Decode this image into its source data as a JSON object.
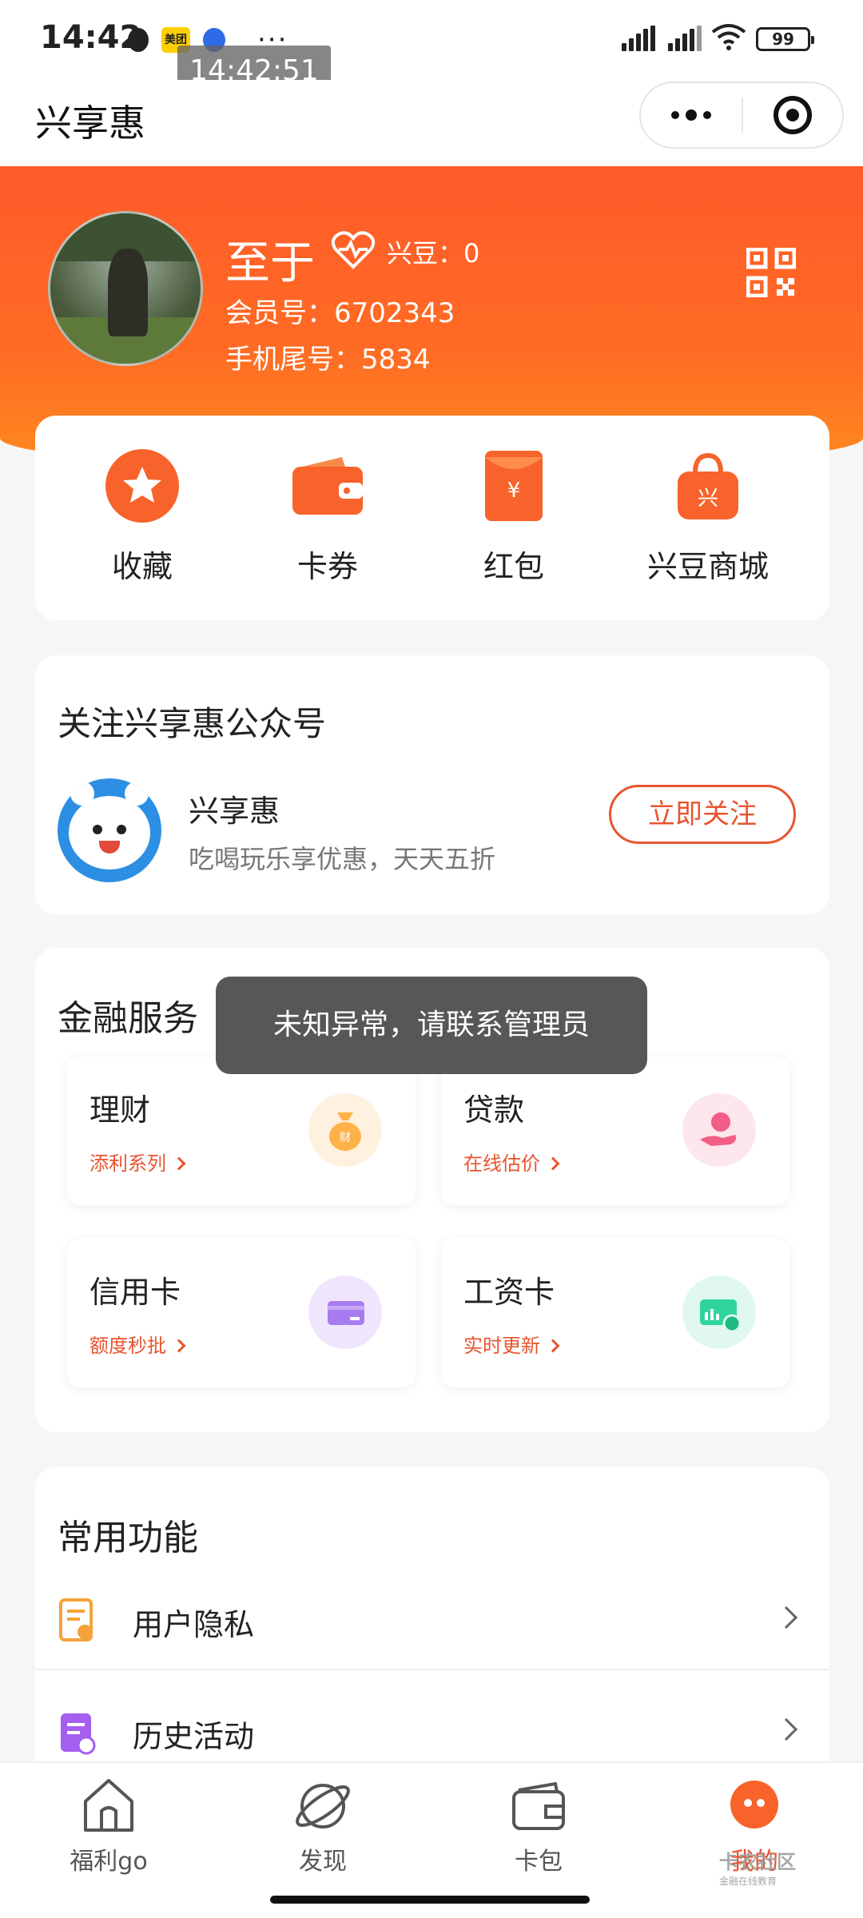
{
  "status_bar": {
    "time": "14:42",
    "time_overlay": "14:42:51",
    "more": "···",
    "battery": "99",
    "app_icon_meituan": "美团"
  },
  "nav": {
    "title": "兴享惠"
  },
  "profile": {
    "name": "至于",
    "points_label": "兴豆：0",
    "member_no": "会员号：6702343",
    "phone_tail": "手机尾号：5834"
  },
  "quick_actions": [
    {
      "label": "收藏",
      "icon": "star-icon"
    },
    {
      "label": "卡券",
      "icon": "wallet-icon"
    },
    {
      "label": "红包",
      "icon": "red-envelope-icon"
    },
    {
      "label": "兴豆商城",
      "icon": "shopping-bag-icon"
    }
  ],
  "follow": {
    "title": "关注兴享惠公众号",
    "account_name": "兴享惠",
    "account_desc": "吃喝玩乐享优惠，天天五折",
    "button": "立即关注"
  },
  "finance": {
    "title": "金融服务",
    "items": [
      {
        "name": "理财",
        "sub": "添利系列",
        "icon": "money-bag-icon",
        "color": "#ffb24a"
      },
      {
        "name": "贷款",
        "sub": "在线估价",
        "icon": "loan-hand-icon",
        "color": "#f25e87"
      },
      {
        "name": "信用卡",
        "sub": "额度秒批",
        "icon": "credit-card-icon",
        "color": "#a77cf0"
      },
      {
        "name": "工资卡",
        "sub": "实时更新",
        "icon": "salary-card-icon",
        "color": "#2fd49a"
      }
    ]
  },
  "toast": "未知异常，请联系管理员",
  "common": {
    "title": "常用功能",
    "items": [
      {
        "label": "用户隐私",
        "icon": "privacy-document-icon"
      },
      {
        "label": "历史活动",
        "icon": "history-activity-icon"
      }
    ]
  },
  "tabs": [
    {
      "label": "福利go",
      "icon": "home-icon"
    },
    {
      "label": "发现",
      "icon": "planet-icon"
    },
    {
      "label": "卡包",
      "icon": "card-wallet-icon"
    },
    {
      "label": "我的",
      "icon": "profile-face-icon"
    }
  ],
  "watermark": {
    "main": "卡农社区",
    "sub": "金融在线教育"
  },
  "colors": {
    "brand_orange": "#ff5a2a",
    "accent_red": "#e8542f"
  }
}
